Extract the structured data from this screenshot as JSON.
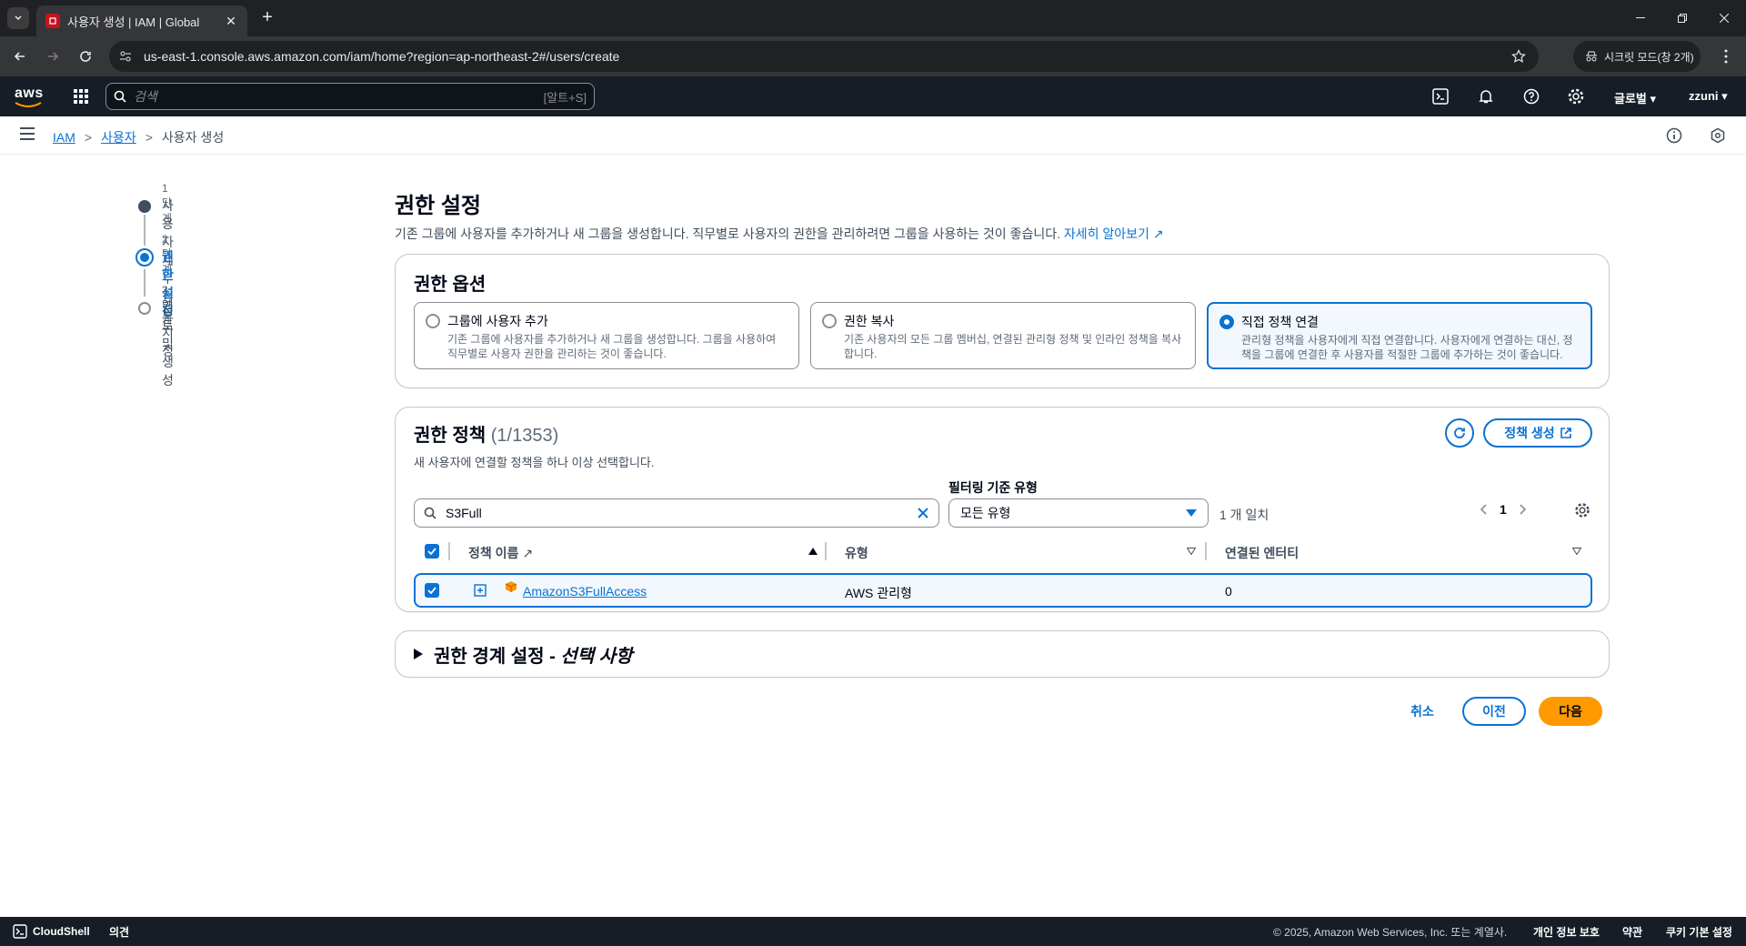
{
  "browser": {
    "tab_title": "사용자 생성 | IAM | Global",
    "url": "us-east-1.console.aws.amazon.com/iam/home?region=ap-northeast-2#/users/create",
    "incognito_label": "시크릿 모드(창 2개)"
  },
  "aws_nav": {
    "logo": "aws",
    "search_placeholder": "검색",
    "search_shortcut": "[알트+S]",
    "region": "글로벌 ▾",
    "account": "zzuni ▾"
  },
  "breadcrumb": {
    "items": [
      "IAM",
      "사용자"
    ],
    "current": "사용자 생성"
  },
  "wizard": {
    "steps": [
      {
        "label": "1단계",
        "name": "사용자 세부 정보 지정",
        "state": "done"
      },
      {
        "label": "2단계",
        "name": "권한 설정",
        "state": "current"
      },
      {
        "label": "3단계",
        "name": "검토 및 생성",
        "state": "todo"
      }
    ]
  },
  "page": {
    "title": "권한 설정",
    "description": "기존 그룹에 사용자를 추가하거나 새 그룹을 생성합니다. 직무별로 사용자의 권한을 관리하려면 그룹을 사용하는 것이 좋습니다.",
    "learn_more": "자세히 알아보기"
  },
  "permission_options": {
    "title": "권한 옵션",
    "tiles": [
      {
        "title": "그룹에 사용자 추가",
        "desc": "기존 그룹에 사용자를 추가하거나 새 그룹을 생성합니다. 그룹을 사용하여 직무별로 사용자 권한을 관리하는 것이 좋습니다.",
        "selected": false
      },
      {
        "title": "권한 복사",
        "desc": "기존 사용자의 모든 그룹 멤버십, 연결된 관리형 정책 및 인라인 정책을 복사합니다.",
        "selected": false
      },
      {
        "title": "직접 정책 연결",
        "desc": "관리형 정책을 사용자에게 직접 연결합니다. 사용자에게 연결하는 대신, 정책을 그룹에 연결한 후 사용자를 적절한 그룹에 추가하는 것이 좋습니다.",
        "selected": true
      }
    ]
  },
  "policies": {
    "title": "권한 정책",
    "count": "(1/1353)",
    "subtitle": "새 사용자에 연결할 정책을 하나 이상 선택합니다.",
    "create_button": "정책 생성",
    "filter_value": "S3Full",
    "type_filter_label": "필터링 기준 유형",
    "type_filter_value": "모든 유형",
    "matches": "1 개 일치",
    "page": "1",
    "columns": [
      "정책 이름",
      "유형",
      "연결된 엔터티"
    ],
    "rows": [
      {
        "name": "AmazonS3FullAccess",
        "type": "AWS 관리형",
        "attached": "0",
        "checked": true
      }
    ]
  },
  "boundary": {
    "title": "권한 경계 설정 - ",
    "optional": "선택 사항"
  },
  "actions": {
    "cancel": "취소",
    "previous": "이전",
    "next": "다음"
  },
  "footer": {
    "cloudshell": "CloudShell",
    "feedback": "의견",
    "copyright": "© 2025, Amazon Web Services, Inc. 또는 계열사.",
    "privacy": "개인 정보 보호",
    "terms": "약관",
    "cookies": "쿠키 기본 설정"
  },
  "colors": {
    "accent": "#0972d3",
    "primary_button": "#ff9900",
    "nav_bg": "#161d26"
  }
}
